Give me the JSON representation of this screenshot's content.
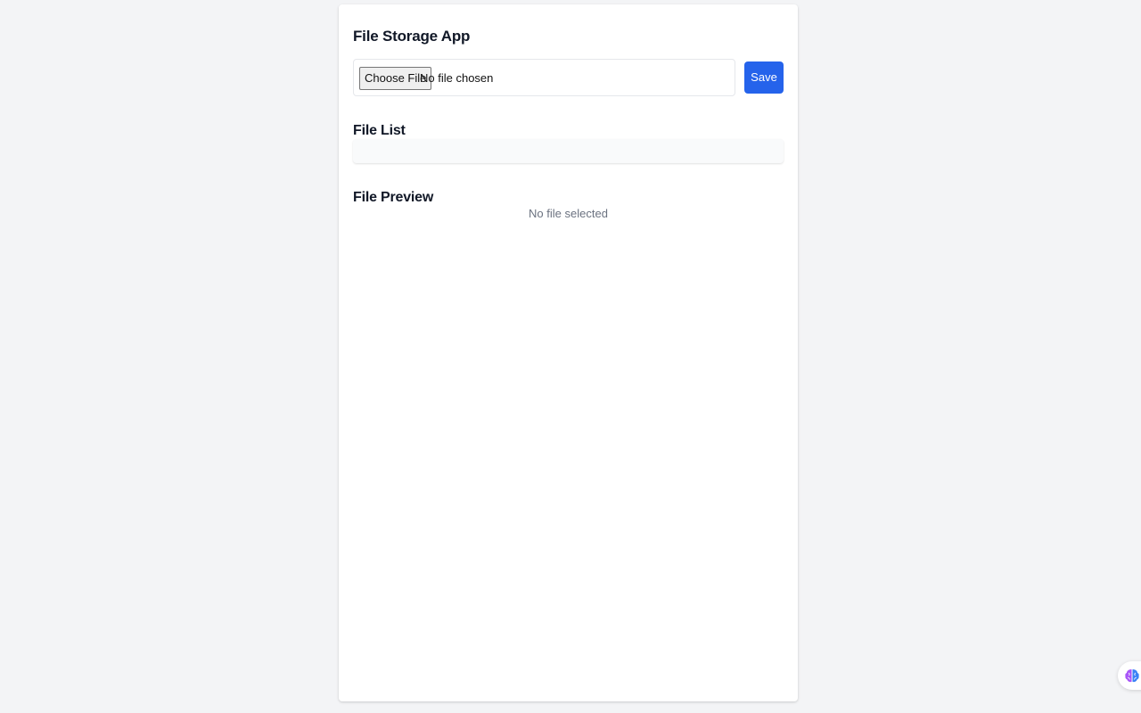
{
  "app": {
    "title": "File Storage App"
  },
  "upload": {
    "choose_label": "Choose File",
    "status_text": "No file chosen",
    "save_label": "Save"
  },
  "file_list": {
    "heading": "File List",
    "items": []
  },
  "preview": {
    "heading": "File Preview",
    "empty_text": "No file selected"
  },
  "widget": {
    "icon": "brain-icon"
  },
  "colors": {
    "accent": "#2563eb",
    "page_bg": "#f3f4f6",
    "card_bg": "#ffffff",
    "muted_text": "#6b7280"
  }
}
